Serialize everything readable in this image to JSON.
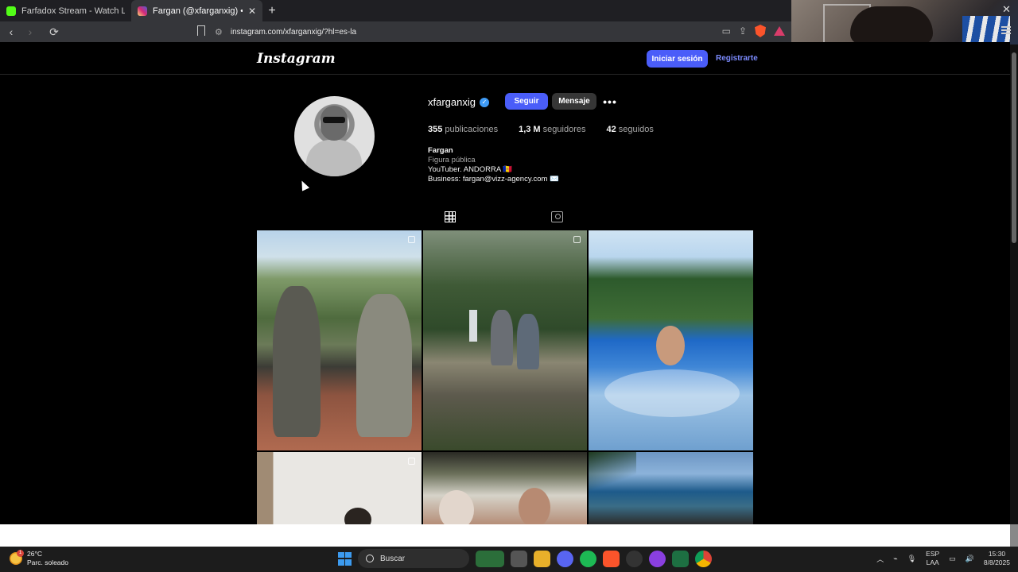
{
  "browser": {
    "tabs": [
      {
        "title": "Farfadox Stream - Watch Live on Kick",
        "favicon_color": "#53fc18",
        "active": false
      },
      {
        "title": "Fargan (@xfarganxig) • Fotos y v",
        "favicon_color": "#e1306c",
        "active": true
      }
    ],
    "new_tab_symbol": "+",
    "close_symbol": "✕",
    "url": "instagram.com/xfarganxig/?hl=es-la",
    "back_icon": "back-arrow-icon",
    "forward_icon": "forward-arrow-icon",
    "reload_icon": "reload-icon"
  },
  "instagram": {
    "logo": "Instagram",
    "login_label": "Iniciar sesión",
    "register_label": "Registrarte",
    "profile": {
      "username": "xfarganxig",
      "verified_mark": "✓",
      "follow_label": "Seguir",
      "message_label": "Mensaje",
      "more_label": "•••",
      "stats": {
        "posts_count": "355",
        "posts_label": "publicaciones",
        "followers_count": "1,3 M",
        "followers_label": "seguidores",
        "following_count": "42",
        "following_label": "seguidos"
      },
      "bio": {
        "name": "Fargan",
        "category": "Figura pública",
        "line1": "YouTuber. ANDORRA 🇦🇩",
        "line2": "Business: fargan@vizz-agency.com ✉️"
      }
    },
    "tabs": [
      "grid-icon",
      "tagged-icon"
    ],
    "posts": [
      {
        "desc": "two-men-on-balcony"
      },
      {
        "desc": "men-at-waterfall"
      },
      {
        "desc": "man-in-pool"
      },
      {
        "desc": "interior-photo"
      },
      {
        "desc": "two-men-indoors"
      },
      {
        "desc": "ocean-coast"
      }
    ]
  },
  "taskbar": {
    "weather_temp": "26°C",
    "weather_desc": "Parc. soleado",
    "weather_badge": "1",
    "search_label": "Buscar",
    "lang_line1": "ESP",
    "lang_line2": "LAA",
    "time": "15:30",
    "date": "8/8/2025"
  }
}
